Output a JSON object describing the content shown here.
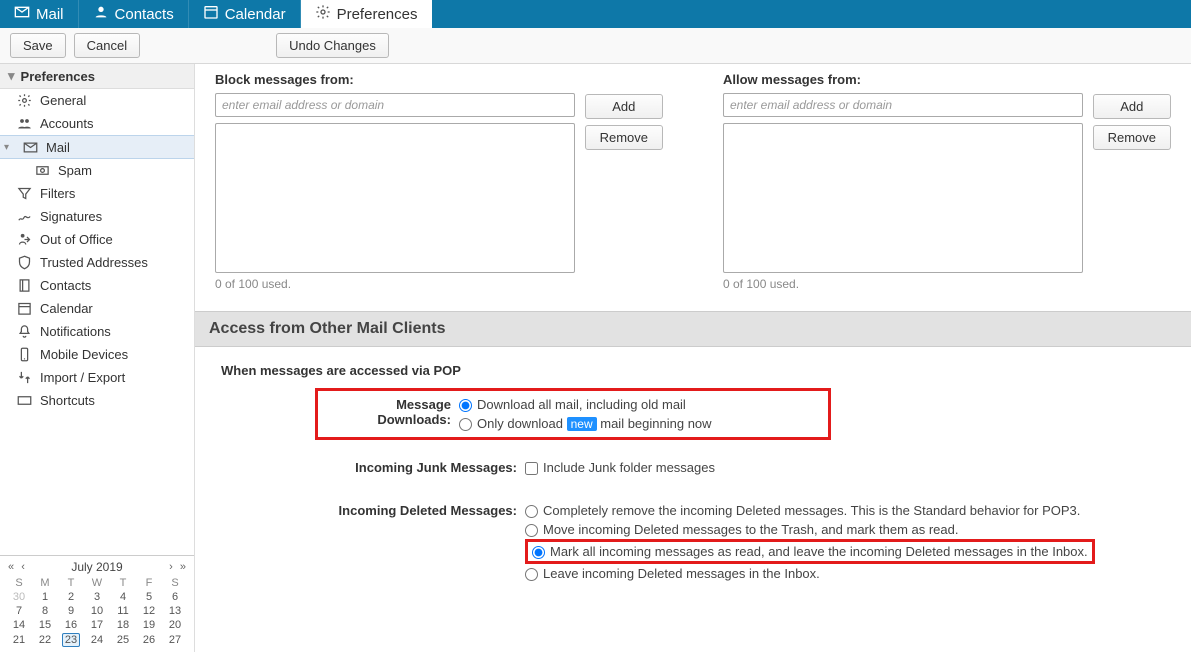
{
  "topbar": {
    "tabs": [
      {
        "label": "Mail"
      },
      {
        "label": "Contacts"
      },
      {
        "label": "Calendar"
      },
      {
        "label": "Preferences"
      }
    ]
  },
  "actions": {
    "save": "Save",
    "cancel": "Cancel",
    "undo": "Undo Changes"
  },
  "sidebar": {
    "header": "Preferences",
    "items": [
      {
        "label": "General"
      },
      {
        "label": "Accounts"
      },
      {
        "label": "Mail"
      },
      {
        "label": "Spam"
      },
      {
        "label": "Filters"
      },
      {
        "label": "Signatures"
      },
      {
        "label": "Out of Office"
      },
      {
        "label": "Trusted Addresses"
      },
      {
        "label": "Contacts"
      },
      {
        "label": "Calendar"
      },
      {
        "label": "Notifications"
      },
      {
        "label": "Mobile Devices"
      },
      {
        "label": "Import / Export"
      },
      {
        "label": "Shortcuts"
      }
    ]
  },
  "calendar": {
    "title": "July 2019",
    "dow": [
      "S",
      "M",
      "T",
      "W",
      "T",
      "F",
      "S"
    ],
    "rows": [
      [
        "30",
        "1",
        "2",
        "3",
        "4",
        "5",
        "6"
      ],
      [
        "7",
        "8",
        "9",
        "10",
        "11",
        "12",
        "13"
      ],
      [
        "14",
        "15",
        "16",
        "17",
        "18",
        "19",
        "20"
      ],
      [
        "21",
        "22",
        "23",
        "24",
        "25",
        "26",
        "27"
      ]
    ],
    "today": "23"
  },
  "block": {
    "blockTitle": "Block messages from:",
    "allowTitle": "Allow messages from:",
    "placeholder": "enter email address or domain",
    "add": "Add",
    "remove": "Remove",
    "used": "0 of 100 used."
  },
  "pop": {
    "sectionTitle": "Access from Other Mail Clients",
    "subhead": "When messages are accessed via POP",
    "downloads": {
      "label": "Message Downloads:",
      "opt1": "Download all mail, including old mail",
      "opt2a": "Only download ",
      "opt2pill": "new",
      "opt2b": " mail beginning now"
    },
    "junk": {
      "label": "Incoming Junk Messages:",
      "opt": "Include Junk folder messages"
    },
    "deleted": {
      "label": "Incoming Deleted Messages:",
      "opt1": "Completely remove the incoming Deleted messages. This is the Standard behavior for POP3.",
      "opt2": "Move incoming Deleted messages to the Trash, and mark them as read.",
      "opt3": "Mark all incoming messages as read, and leave the incoming Deleted messages in the Inbox.",
      "opt4": "Leave incoming Deleted messages in the Inbox."
    }
  }
}
